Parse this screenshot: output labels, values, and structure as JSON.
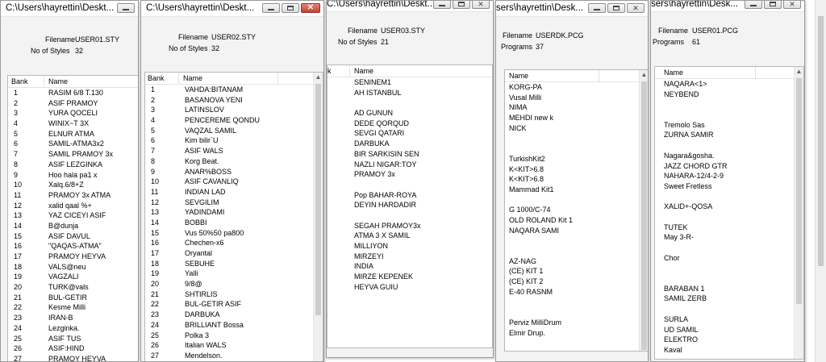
{
  "w1": {
    "title": "C:\\Users\\hayrettin\\Deskt...",
    "filename_label": "Filename",
    "filename": "USER01.STY",
    "count_label": "No of Styles",
    "count": "32",
    "col_bank": "Bank",
    "col_name": "Name",
    "rows": [
      [
        "1",
        "RASIM 6/8 T.130"
      ],
      [
        "2",
        "ASIF PRAMOY"
      ],
      [
        "3",
        "YURA QOCELI"
      ],
      [
        "4",
        "WINIX~T 3X"
      ],
      [
        "5",
        "ELNUR ATMA"
      ],
      [
        "6",
        "SAMIL-ATMA3x2"
      ],
      [
        "7",
        "SAMIL PRAMOY 3x"
      ],
      [
        "8",
        "ASIF LEZGINKA"
      ],
      [
        "9",
        "Hoo hala  pa1 x"
      ],
      [
        "10",
        "Xalq.6/8+Z"
      ],
      [
        "11",
        "PRAMOY 3x ATMA"
      ],
      [
        "12",
        "  xalid qaal %+"
      ],
      [
        "13",
        "YAZ CICEYI ASIF"
      ],
      [
        "14",
        "B@dunja"
      ],
      [
        "15",
        "ASIF DAVUL"
      ],
      [
        "16",
        "\"QAQAS-ATMA\""
      ],
      [
        "17",
        "PRAMOY HEYVA"
      ],
      [
        "18",
        "VALS@neu"
      ],
      [
        "19",
        "VAGZALI"
      ],
      [
        "20",
        "TURK@vals"
      ],
      [
        "21",
        "BUL-GETIR"
      ],
      [
        "22",
        "Kesme Milli"
      ],
      [
        "23",
        "IRAN-B"
      ],
      [
        "24",
        "Lezginka."
      ],
      [
        "25",
        "ASIF TUS"
      ],
      [
        "26",
        "ASIF:HIND"
      ],
      [
        "27",
        "PRAMOY HEYVA"
      ]
    ]
  },
  "w2": {
    "title": "C:\\Users\\hayrettin\\Deskt...",
    "filename_label": "Filename",
    "filename": "USER02.STY",
    "count_label": "No of Styles",
    "count": "32",
    "col_bank": "Bank",
    "col_name": "Name",
    "rows": [
      [
        "1",
        "VAHDA:BITANAM"
      ],
      [
        "2",
        "BASANOVA YENI"
      ],
      [
        "3",
        "LATINSLOV"
      ],
      [
        "4",
        "PENCEREME QONDU"
      ],
      [
        "5",
        "VAQZAL SAMIL"
      ],
      [
        "6",
        "Kim bilir`U"
      ],
      [
        "7",
        "ASIF WALS"
      ],
      [
        "8",
        "Korg Beat."
      ],
      [
        "9",
        "ANAR%BOSS"
      ],
      [
        "10",
        "ASIF CAVANLIQ"
      ],
      [
        "11",
        "INDIAN LAD"
      ],
      [
        "12",
        "SEVGILIM"
      ],
      [
        "13",
        "YADINDAMI"
      ],
      [
        "14",
        "BOBBI"
      ],
      [
        "15",
        "Vus 50%50 pa800"
      ],
      [
        "16",
        "Chechen-x6"
      ],
      [
        "17",
        "Oryantal"
      ],
      [
        "18",
        "SEBUHE"
      ],
      [
        "19",
        "Yalli"
      ],
      [
        "20",
        "9/8@"
      ],
      [
        "21",
        "SHTIRLIS"
      ],
      [
        "22",
        "BUL-GETIR ASIF"
      ],
      [
        "23",
        "DARBUKA"
      ],
      [
        "24",
        "BRILLIANT Bossa"
      ],
      [
        "25",
        "Polka 3"
      ],
      [
        "26",
        "Italian WALS"
      ],
      [
        "27",
        "Mendelson."
      ]
    ]
  },
  "w3": {
    "title": "C:\\Users\\hayrettin\\Deskt...",
    "filename_label": "Filename",
    "filename": "USER03.STY",
    "count_label": "No of Styles",
    "count": "21",
    "col_bank": "k",
    "col_name": "Name",
    "rows": [
      "SENINEM1",
      "AH ISTANBUL",
      "",
      "AD GUNUN",
      "DEDE QORQUD",
      "SEVGI QATARI",
      "DARBUKA",
      "BIR SARKISIN SEN",
      "NAZLI NIGAR:TOY",
      "PRAMOY 3x",
      "",
      "Pop BAHAR-ROYA",
      "DEYIN HARDADIR",
      "",
      "SEGAH PRAMOY3x",
      "ATMA 3 X SAMIL",
      "MILLIYON",
      "MIRZEYI",
      "INDIA",
      "MIRZE KEPENEK",
      "HEYVA GUIU"
    ]
  },
  "w4": {
    "title": "sers\\hayrettin\\Desk...",
    "filename_label": "Filename",
    "filename": "USERDK.PCG",
    "count_label": "Programs",
    "count": "37",
    "col_name": "Name",
    "rows": [
      "KORG-PA",
      "Vusal Milli",
      "NIMA",
      "MEHDI new k",
      "NICK",
      "",
      "",
      "TurkishKit2",
      "K<KIT>6.8",
      "K<KIT>6.8",
      "Mammad Kit1",
      "",
      "G 1000/C-74",
      "OLD ROLAND Kit 1",
      "NAQARA SAMI",
      "",
      "",
      "AZ-NAG",
      "(CE) KIT 1",
      "(CE) KIT 2",
      "E-40 RASNM",
      "",
      "",
      "Perviz MilliDrum",
      "Elmir Drup."
    ]
  },
  "w5": {
    "title": "sers\\hayrettin\\Desk...",
    "filename_label": "Filename",
    "filename": "USER01.PCG",
    "count_label": "Programs",
    "count": "61",
    "col_name": "Name",
    "rows": [
      "NAQARA<1>",
      "NEYBEND",
      "",
      "",
      "Tremolo Sas",
      "ZURNA SAMIR",
      "",
      "Nagara&gosha.",
      "JAZZ CHORD GTR",
      "NAHARA-12/4-2-9",
      "Sweet Fretless",
      "",
      "XALID+-QOSA",
      "",
      "TUTEK",
      "May 3-R-",
      "",
      "Chor",
      "",
      "",
      "BARABAN 1",
      "SAMIL ZERB",
      "",
      "SURLA",
      "UD SAMIL",
      "ELEKTRO",
      "Kaval"
    ]
  }
}
